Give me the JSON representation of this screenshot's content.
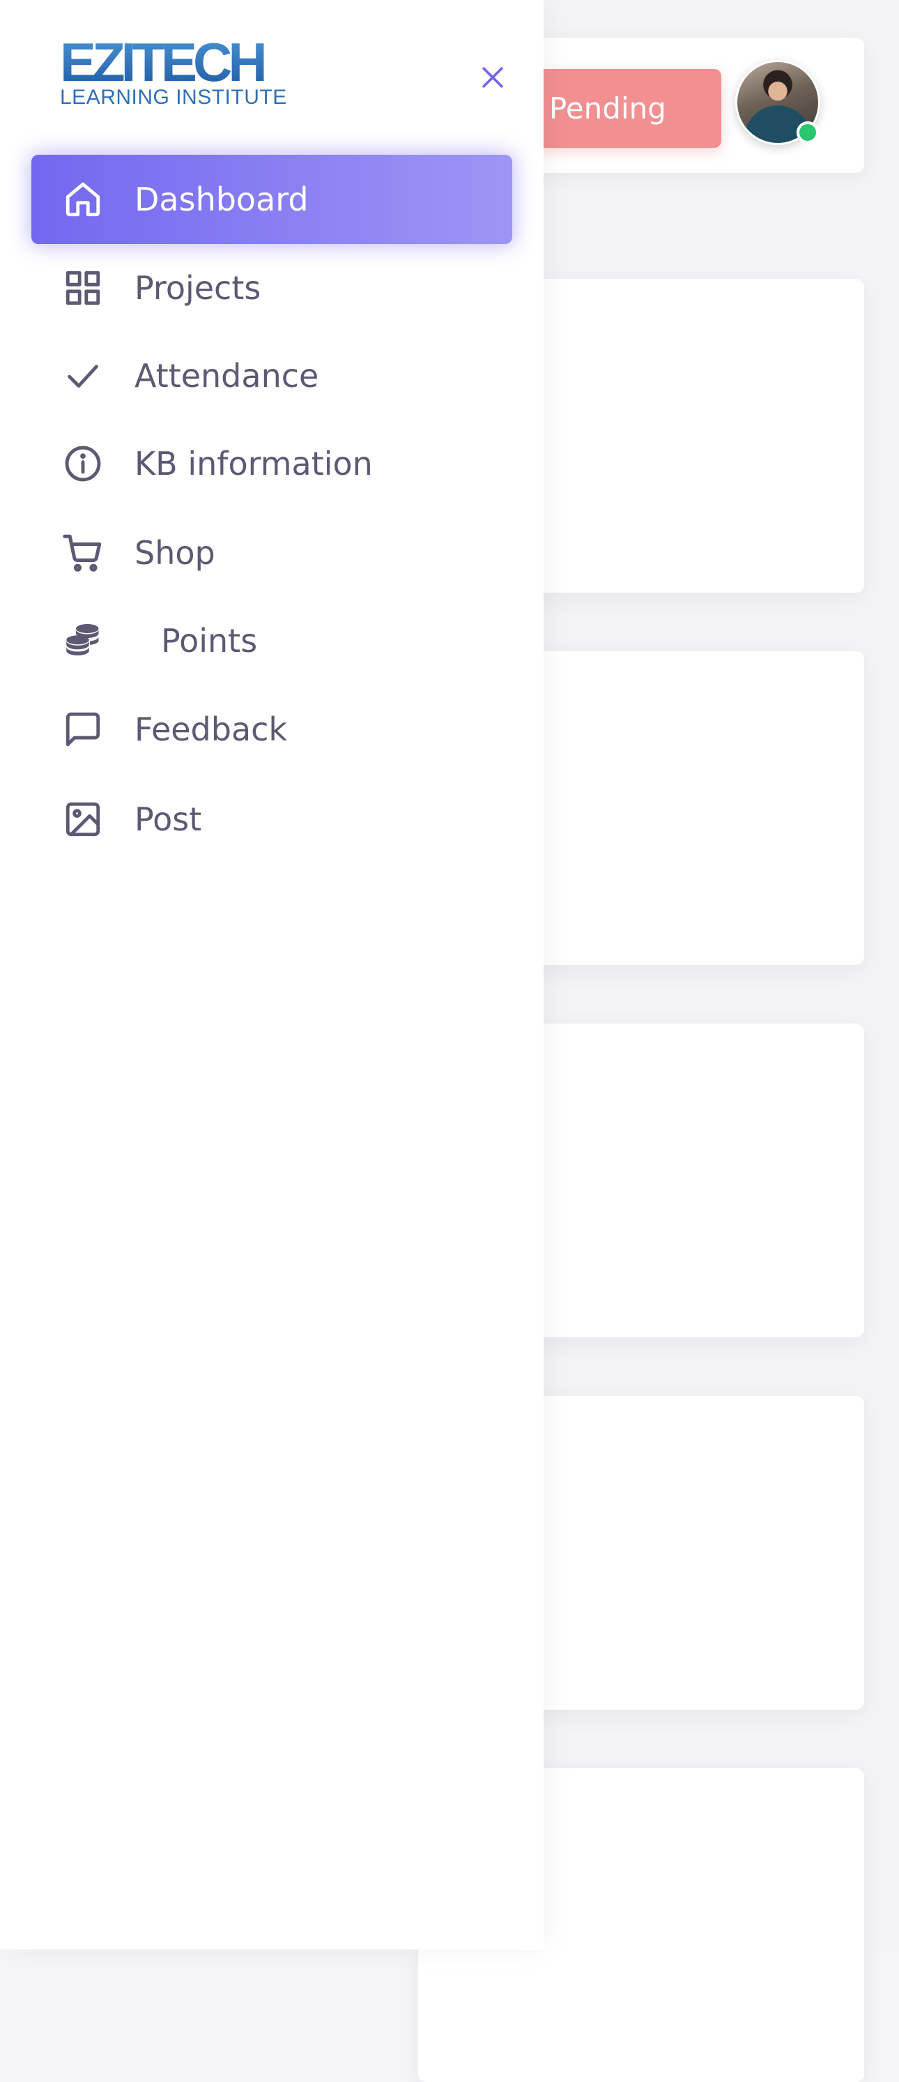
{
  "app": {
    "brand_main": "EZITECH",
    "brand_sub": "LEARNING INSTITUTE"
  },
  "header": {
    "status_badge": "Pending",
    "online_status_color": "#28c76f"
  },
  "drawer": {
    "close_icon": "close-icon",
    "accent_color": "#7367f0",
    "items": [
      {
        "label": "Dashboard",
        "icon": "home-icon",
        "active": true
      },
      {
        "label": "Projects",
        "icon": "grid-icon",
        "active": false
      },
      {
        "label": "Attendance",
        "icon": "check-icon",
        "active": false
      },
      {
        "label": "KB information",
        "icon": "info-icon",
        "active": false
      },
      {
        "label": "Shop",
        "icon": "cart-icon",
        "active": false
      },
      {
        "label": "Points",
        "icon": "coins-icon",
        "active": false
      },
      {
        "label": "Feedback",
        "icon": "message-icon",
        "active": false
      },
      {
        "label": "Post",
        "icon": "image-icon",
        "active": false
      }
    ]
  }
}
